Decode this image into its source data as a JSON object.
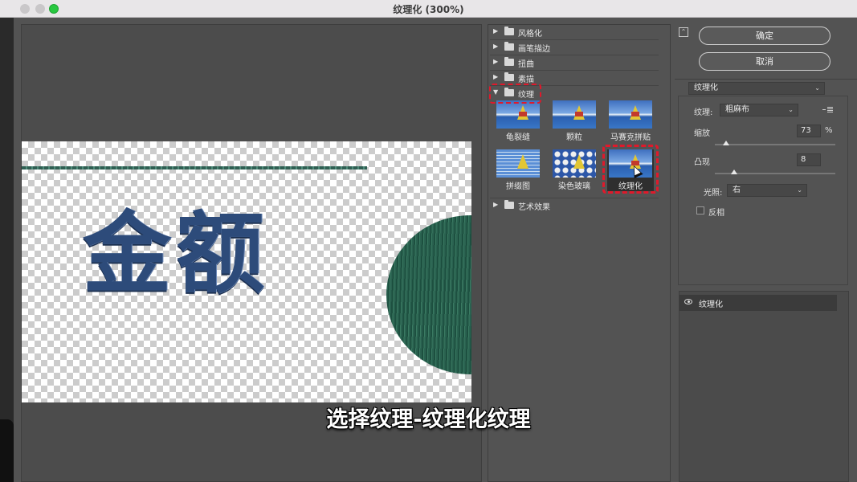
{
  "window": {
    "title": "纹理化 (300%)"
  },
  "preview": {
    "sample_text": "金额",
    "caption": "选择纹理-纹理化纹理"
  },
  "filter_gallery": {
    "categories": [
      {
        "label": "风格化",
        "expanded": false
      },
      {
        "label": "画笔描边",
        "expanded": false
      },
      {
        "label": "扭曲",
        "expanded": false
      },
      {
        "label": "素描",
        "expanded": false
      },
      {
        "label": "纹理",
        "expanded": true
      },
      {
        "label": "艺术效果",
        "expanded": false
      }
    ],
    "texture_filters": [
      "龟裂缝",
      "颗粒",
      "马赛克拼贴",
      "拼缀图",
      "染色玻璃",
      "纹理化"
    ],
    "selected_filter": "纹理化"
  },
  "controls": {
    "ok_label": "确定",
    "cancel_label": "取消",
    "effect_dropdown": "纹理化",
    "texture_label": "纹理:",
    "texture_value": "粗麻布",
    "scaling_label": "缩放",
    "scaling_value": "73",
    "scaling_unit": "%",
    "scaling_level": 0.09,
    "relief_label": "凸现",
    "relief_value": "8",
    "relief_level": 0.16,
    "light_label": "光照:",
    "light_value": "右",
    "invert_label": "反相",
    "invert_checked": false
  },
  "effect_layers": [
    {
      "label": "纹理化",
      "visible": true
    }
  ],
  "icons": {
    "expand": "triangle-right-icon",
    "collapse": "triangle-down-icon",
    "folder": "folder-icon",
    "eye": "eye-icon",
    "panel_collapse": "collapse-panel-icon",
    "panel_menu": "panel-menu-icon"
  },
  "colors": {
    "highlight_annotation": "#e0192b",
    "panel_bg": "#535353",
    "maximize_button": "#28c840"
  }
}
